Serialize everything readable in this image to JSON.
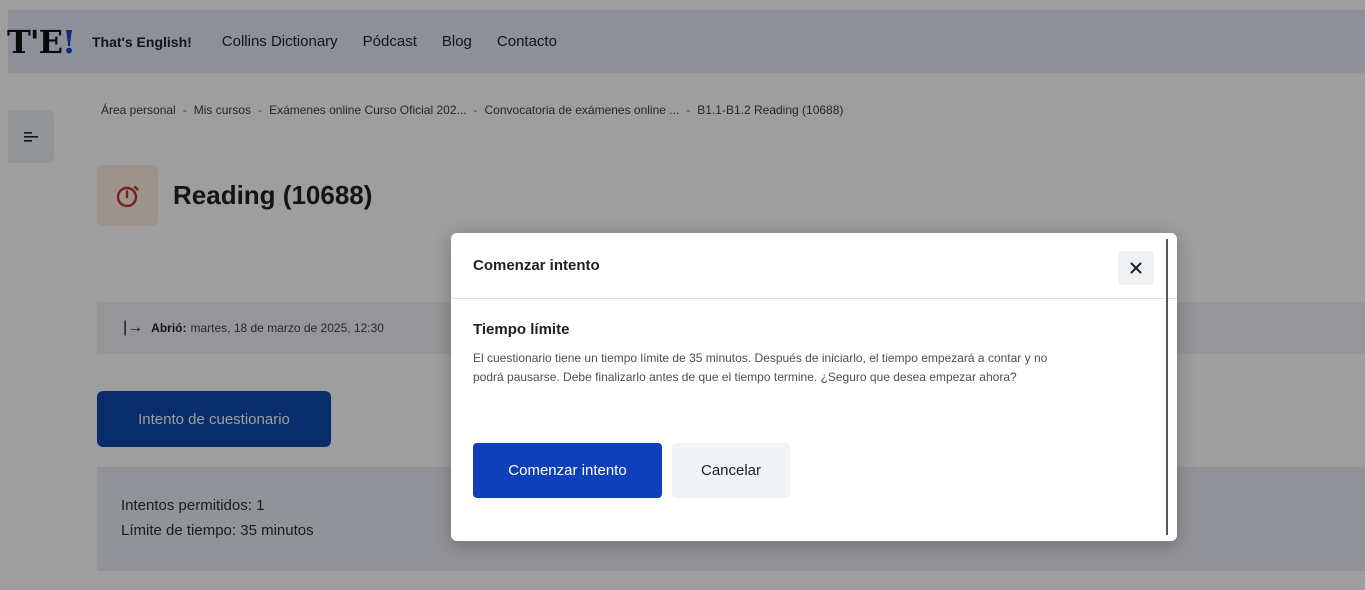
{
  "navbar": {
    "logo_main": "T'E",
    "logo_bang": "!",
    "brand": "That's English!",
    "links": [
      "Collins Dictionary",
      "Pódcast",
      "Blog",
      "Contacto"
    ]
  },
  "breadcrumb": {
    "items": [
      "Área personal",
      "Mis cursos",
      "Exámenes online Curso Oficial 202...",
      "Convocatoria de exámenes online ...",
      "B1.1-B1.2 Reading (10688)"
    ],
    "separator": "-"
  },
  "page": {
    "title": "Reading (10688)",
    "icon": "stopwatch-icon",
    "icon_color": "#c0392b",
    "dates_arrow": "|→",
    "opened_label": "Abrió:",
    "opened_value": "martes, 18 de marzo de 2025, 12:30",
    "attempt_button": "Intento de cuestionario",
    "attempts_allowed": "Intentos permitidos: 1",
    "time_limit": "Límite de tiempo: 35 minutos"
  },
  "modal": {
    "title": "Comenzar intento",
    "close_icon": "close-icon",
    "subtitle": "Tiempo límite",
    "body": "El cuestionario tiene un tiempo límite de 35 minutos. Después de iniciarlo, el tiempo empezará a contar y no podrá pausarse. Debe finalizarlo antes de que el tiempo termine. ¿Seguro que desea empezar ahora?",
    "primary_button": "Comenzar intento",
    "secondary_button": "Cancelar"
  },
  "colors": {
    "navbar_bg": "#e4e9f7",
    "primary": "#0f47ad",
    "logo_accent": "#1f3fd6"
  }
}
